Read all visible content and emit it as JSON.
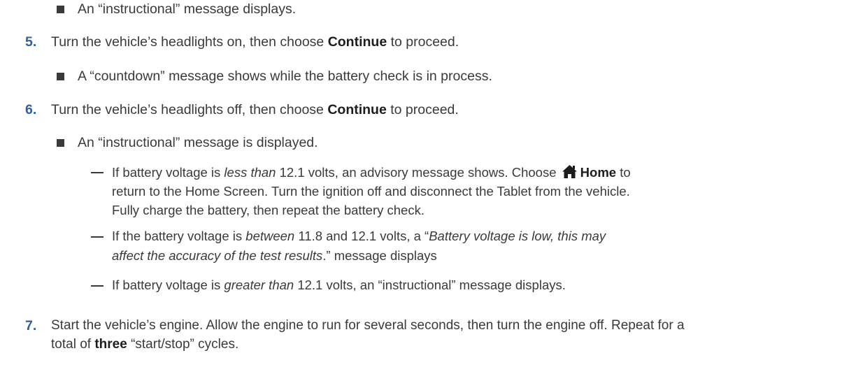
{
  "items": [
    {
      "type": "bullet",
      "text": "An “instructional” message displays."
    },
    {
      "type": "step",
      "num": "5.",
      "pre": "Turn the vehicle’s headlights on, then choose ",
      "bold": "Continue",
      "post": " to proceed."
    },
    {
      "type": "bullet",
      "text": "A “countdown” message shows while the battery check is in process."
    },
    {
      "type": "step",
      "num": "6.",
      "pre": "Turn the vehicle’s headlights off, then choose ",
      "bold": "Continue",
      "post": " to proceed."
    },
    {
      "type": "bullet",
      "text": "An “instructional” message is displayed."
    }
  ],
  "dash1": {
    "l1_pre": "If battery voltage is ",
    "l1_em": "less than",
    "l1_mid": " 12.1 volts, an advisory message shows. Choose ",
    "home_label": "Home",
    "l1_post": " to",
    "l2": "return to the Home Screen. Turn the ignition off and disconnect the Tablet from the vehicle.",
    "l3": "Fully charge the battery, then repeat the battery check."
  },
  "dash2": {
    "l1_pre": "If the battery voltage is ",
    "l1_em": "between",
    "l1_mid": " 11.8 and 12.1 volts, a “",
    "l1_em2": "Battery voltage is low, this may",
    "l2_em": "affect the accuracy of the test results",
    "l2_post": ".” message displays"
  },
  "dash3": {
    "pre": "If battery voltage is ",
    "em": "greater than",
    "post": " 12.1 volts, an “instructional” message displays."
  },
  "step7": {
    "num": "7.",
    "l1": "Start the vehicle’s engine. Allow the engine to run for several seconds, then turn the engine off. Repeat for a",
    "l2_pre": "total of ",
    "l2_bold": "three",
    "l2_post": " “start/stop” cycles."
  },
  "icons": {
    "home": "home-icon"
  }
}
